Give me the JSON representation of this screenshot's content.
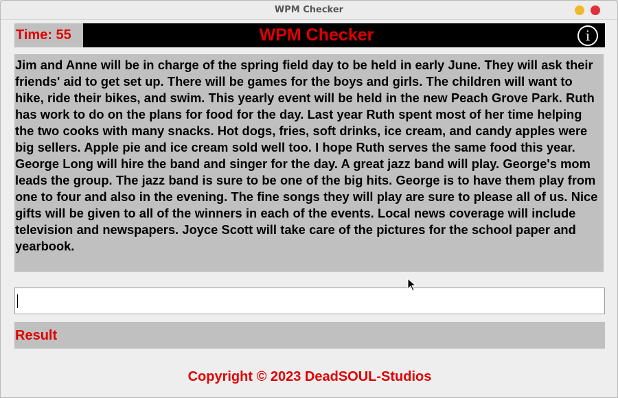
{
  "window": {
    "title": "WPM Checker"
  },
  "header": {
    "timer": "Time: 55",
    "title": "WPM Checker",
    "info_icon": "i"
  },
  "passage": {
    "text": "Jim and Anne will be in charge of the spring field day to be held in early June. They will ask their friends' aid to get set up. There will be games for the boys and girls. The children will want to hike, ride their bikes, and swim. This yearly event will be held in the new Peach Grove Park. Ruth has work to do on the plans for food for the day. Last year Ruth spent most of her time helping the two cooks with many snacks. Hot dogs, fries, soft drinks, ice cream, and candy apples were big sellers. Apple pie and ice cream sold well too. I hope Ruth serves the same food this year. George Long will hire the band and singer for the day. A great jazz band will play. George's mom leads the group. The jazz band is sure to be one of the big hits. George is to have them play from one to four and also in the evening. The fine songs they will play are sure to please all of us. Nice gifts will be given to all of the winners in each of the events. Local news coverage will include television and newspapers. Joyce Scott will take care of the pictures for the school paper and yearbook."
  },
  "input": {
    "value": "",
    "placeholder": ""
  },
  "result": {
    "label": "Result"
  },
  "footer": {
    "copyright": "Copyright © 2023 DeadSOUL-Studios"
  },
  "colors": {
    "accent": "#e00000",
    "panel": "#c0c0c0",
    "header_bg": "#000000"
  }
}
